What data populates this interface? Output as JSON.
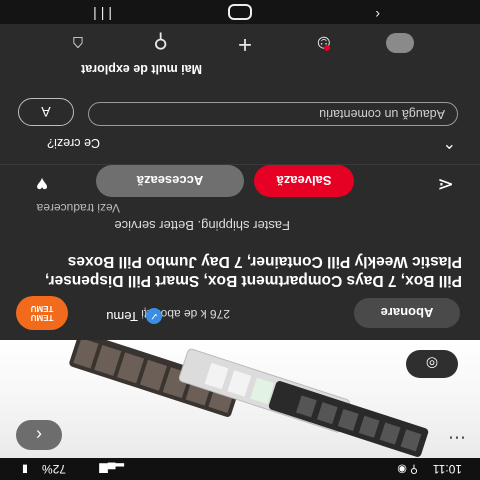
{
  "status_bar": {
    "time": "10:11",
    "battery": "72%"
  },
  "pin": {
    "account_name": "Temu",
    "followers": "276 k de abonați",
    "avatar_text_line1": "TEMU",
    "avatar_text_line2": "TEMU",
    "follow_label": "Abonare",
    "title": "Pill Box, 7 Days Compartment Box, Smart Pill Dispenser, Plastic Weekly Pill Container, 7 Day Jumbo Pill Boxes",
    "description": "Faster shipping. Better service",
    "see_translation": "Vezi traducerea",
    "visit_label": "Accesează",
    "save_label": "Salvează"
  },
  "comments": {
    "heading": "Ce crezi?",
    "input_placeholder": "Adaugă un comentariu",
    "user_initial": "A"
  },
  "more_to_explore": "Mai mult de explorat",
  "colors": {
    "accent": "#e60023",
    "background": "#2b2b2b",
    "brand_avatar": "#f26a1b"
  },
  "icons": {
    "back": "chevron-left-icon",
    "more": "more-dots-icon",
    "lens": "lens-icon",
    "share": "share-icon",
    "react": "heart-icon",
    "collapse": "chevron-up-icon"
  }
}
